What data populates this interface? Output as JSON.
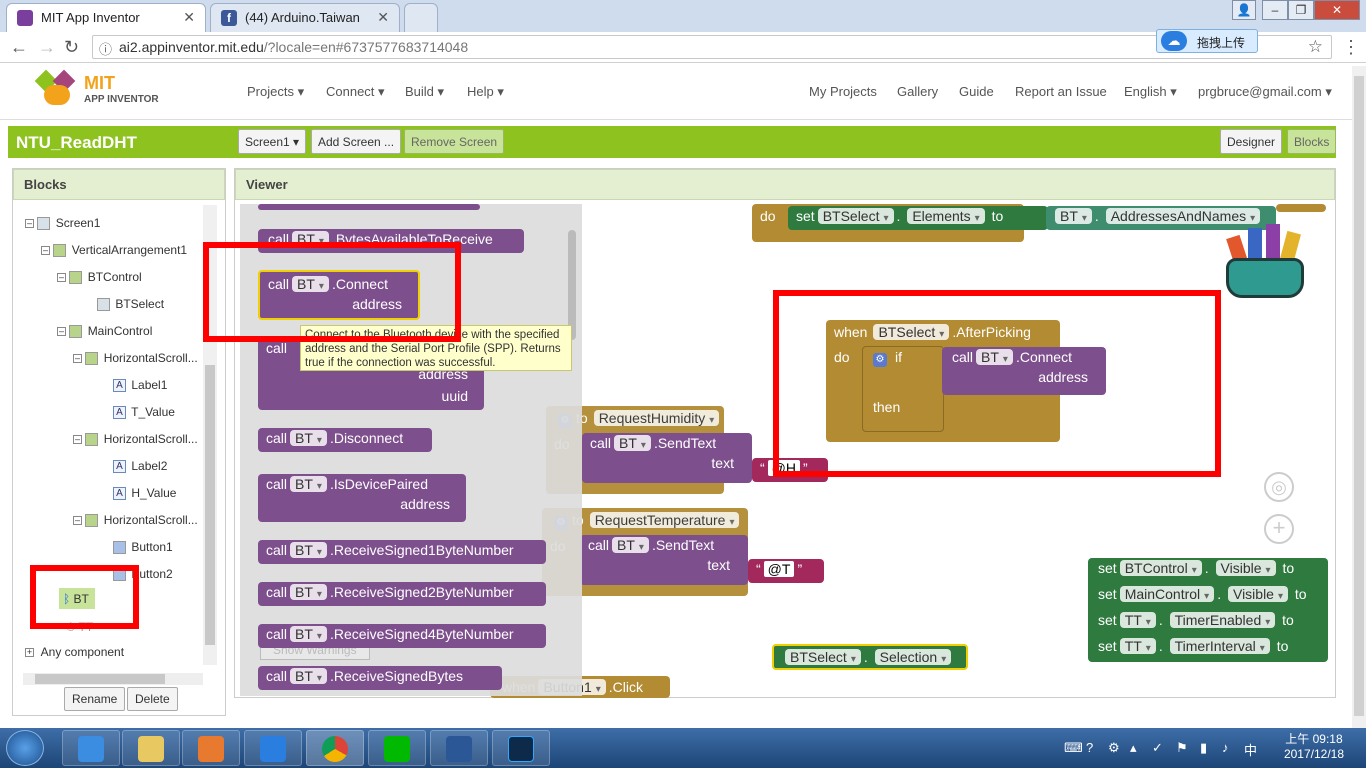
{
  "browser": {
    "tabs": [
      {
        "title": "MIT App Inventor",
        "active": true,
        "icon_color": "#7a3f9d"
      },
      {
        "title": "(44) Arduino.Taiwan",
        "active": false,
        "icon_color": "#3b5998"
      }
    ],
    "url_host": "ai2.appinventor.mit.edu",
    "url_rest": "/?locale=en#6737577683714048",
    "upload_label": "拖拽上传"
  },
  "header": {
    "logo_top": "MIT",
    "logo_bottom": "APP INVENTOR",
    "menus": [
      "Projects",
      "Connect",
      "Build",
      "Help"
    ],
    "right_links": [
      "My Projects",
      "Gallery",
      "Guide",
      "Report an Issue",
      "English",
      "prgbruce@gmail.com"
    ]
  },
  "toolbar": {
    "project": "NTU_ReadDHT",
    "screen_select": "Screen1",
    "add_screen": "Add Screen ...",
    "remove_screen": "Remove Screen",
    "designer": "Designer",
    "blocks": "Blocks"
  },
  "blocks_panel": {
    "title": "Blocks",
    "tree": [
      {
        "label": "Screen1"
      },
      {
        "label": "VerticalArrangement1"
      },
      {
        "label": "BTControl"
      },
      {
        "label": "BTSelect"
      },
      {
        "label": "MainControl"
      },
      {
        "label": "HorizontalScroll..."
      },
      {
        "label": "Label1"
      },
      {
        "label": "T_Value"
      },
      {
        "label": "HorizontalScroll..."
      },
      {
        "label": "Label2"
      },
      {
        "label": "H_Value"
      },
      {
        "label": "HorizontalScroll..."
      },
      {
        "label": "Button1"
      },
      {
        "label": "Button2"
      },
      {
        "label": "BT"
      },
      {
        "label": "TT"
      }
    ],
    "any_component": "Any component",
    "rename": "Rename",
    "delete": "Delete"
  },
  "viewer": {
    "title": "Viewer",
    "show_warnings": "Show Warnings",
    "tooltip": "Connect to the Bluetooth device with the specified address and the Serial Port Profile (SPP). Returns true if the connection was successful.",
    "flyout": [
      {
        "call": "call",
        "comp": "BT",
        "method": ".BytesAvailableToReceive"
      },
      {
        "call": "call",
        "comp": "BT",
        "method": ".Connect",
        "arg": "address"
      },
      {
        "call": "call",
        "args": [
          "address",
          "uuid"
        ]
      },
      {
        "call": "call",
        "comp": "BT",
        "method": ".Disconnect"
      },
      {
        "call": "call",
        "comp": "BT",
        "method": ".IsDevicePaired",
        "arg": "address"
      },
      {
        "call": "call",
        "comp": "BT",
        "method": ".ReceiveSigned1ByteNumber"
      },
      {
        "call": "call",
        "comp": "BT",
        "method": ".ReceiveSigned2ByteNumber"
      },
      {
        "call": "call",
        "comp": "BT",
        "method": ".ReceiveSigned4ByteNumber"
      },
      {
        "call": "call",
        "comp": "BT",
        "method": ".ReceiveSignedBytes"
      }
    ],
    "workspace": {
      "set_elements": {
        "do": "do",
        "set": "set",
        "comp": "BTSelect",
        "prop": "Elements",
        "to": "to",
        "src_comp": "BT",
        "src_prop": "AddressesAndNames"
      },
      "after_picking": {
        "when": "when",
        "comp": "BTSelect",
        "event": ".AfterPicking",
        "do": "do",
        "if": "if",
        "call": "call",
        "call_comp": "BT",
        "call_method": ".Connect",
        "arg": "address",
        "then": "then"
      },
      "req_humidity": {
        "to": "to",
        "name": "RequestHumidity",
        "do": "do",
        "call": "call",
        "comp": "BT",
        "method": ".SendText",
        "arg": "text",
        "value": "@H"
      },
      "req_temp": {
        "to": "to",
        "name": "RequestTemperature",
        "do": "do",
        "call": "call",
        "comp": "BT",
        "method": ".SendText",
        "arg": "text",
        "value": "@T"
      },
      "sets": [
        {
          "set": "set",
          "comp": "BTControl",
          "prop": "Visible",
          "to": "to"
        },
        {
          "set": "set",
          "comp": "MainControl",
          "prop": "Visible",
          "to": "to"
        },
        {
          "set": "set",
          "comp": "TT",
          "prop": "TimerEnabled",
          "to": "to"
        },
        {
          "set": "set",
          "comp": "TT",
          "prop": "TimerInterval",
          "to": "to"
        }
      ],
      "selection": {
        "comp": "BTSelect",
        "prop": "Selection"
      },
      "button_click": {
        "when": "when",
        "comp": "Button1",
        "event": ".Click"
      }
    }
  },
  "taskbar": {
    "time": "上午 09:18",
    "date": "2017/12/18"
  },
  "colors": {
    "green_bar": "#8dc21f",
    "block_purple": "#7e4f8d",
    "block_gold": "#b28b33",
    "block_green": "#2f7a3f",
    "highlight_red": "#ff0000"
  }
}
